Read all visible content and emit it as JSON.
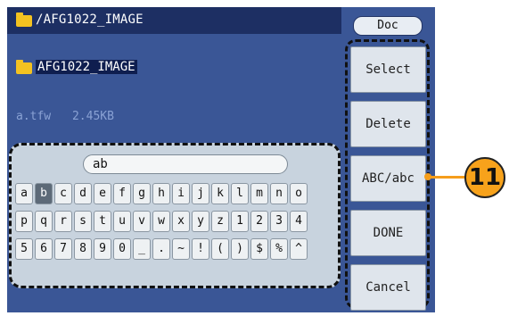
{
  "path_bar": {
    "icon": "folder-icon",
    "path": "/AFG1022_IMAGE"
  },
  "doc_tab": "Doc",
  "folder": {
    "icon": "folder-icon",
    "name": "AFG1022_IMAGE"
  },
  "file": {
    "name": "a.tfw",
    "size": "2.45KB"
  },
  "keyboard": {
    "input_value": "ab",
    "selected_key": "b",
    "rows": [
      [
        "a",
        "b",
        "c",
        "d",
        "e",
        "f",
        "g",
        "h",
        "i",
        "j",
        "k",
        "l",
        "m",
        "n",
        "o"
      ],
      [
        "p",
        "q",
        "r",
        "s",
        "t",
        "u",
        "v",
        "w",
        "x",
        "y",
        "z",
        "1",
        "2",
        "3",
        "4"
      ],
      [
        "5",
        "6",
        "7",
        "8",
        "9",
        "0",
        "_",
        ".",
        "~",
        "!",
        "(",
        ")",
        "$",
        "%",
        "^"
      ]
    ]
  },
  "softkeys": [
    "Select",
    "Delete",
    "ABC/abc",
    "DONE",
    "Cancel"
  ],
  "callout": {
    "label": "11",
    "color": "#f7a21b"
  },
  "colors": {
    "screen_bg": "#3a5696",
    "path_bar_bg": "#1d2f63",
    "folder_icon": "#f3c221"
  }
}
